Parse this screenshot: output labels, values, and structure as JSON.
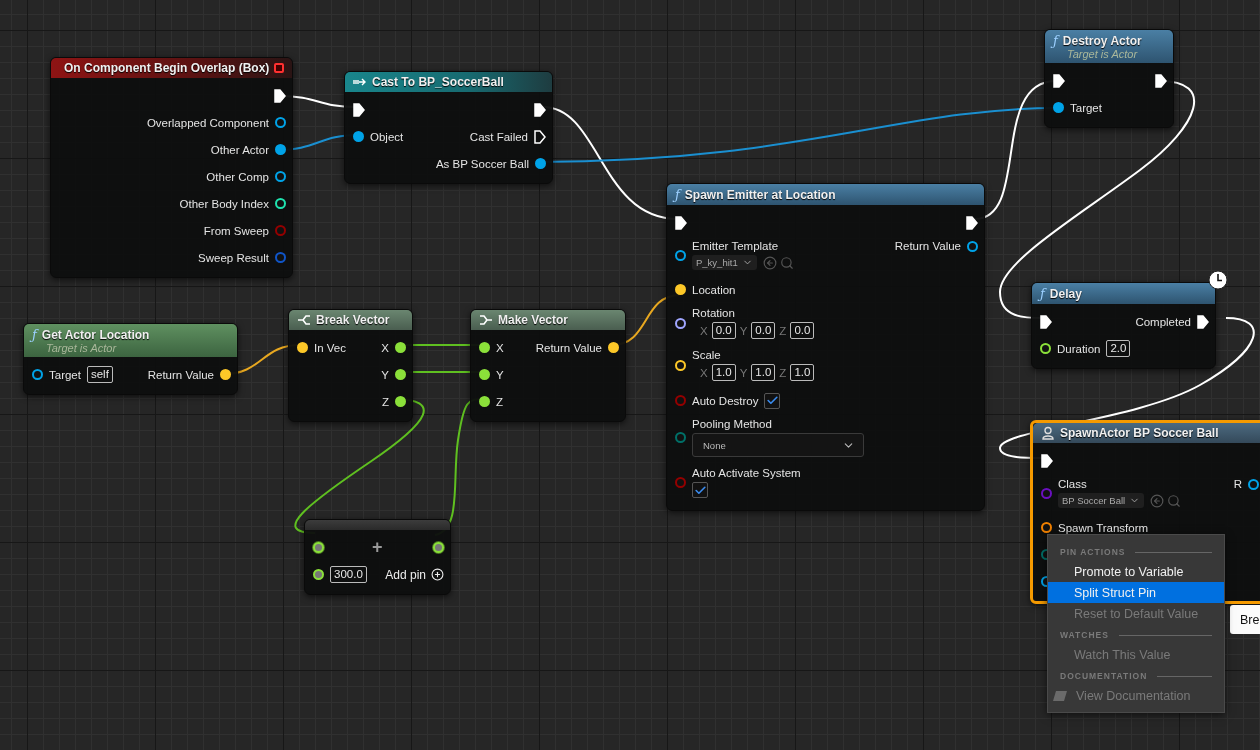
{
  "nodes": [
    {
      "kind": "event",
      "title": "On Component Begin Overlap (Box)",
      "delegate": true,
      "selected": false,
      "rows": [
        {
          "out": {
            "kind": "exec",
            "connected": true
          }
        },
        {
          "out": {
            "kind": "object",
            "label": "Overlapped Component",
            "connected": false
          }
        },
        {
          "out": {
            "kind": "object",
            "label": "Other Actor",
            "connected": true
          }
        },
        {
          "out": {
            "kind": "object",
            "label": "Other Comp",
            "connected": false
          }
        },
        {
          "out": {
            "kind": "int",
            "label": "Other Body Index",
            "connected": false
          }
        },
        {
          "out": {
            "kind": "bool",
            "label": "From Sweep",
            "connected": false
          }
        },
        {
          "out": {
            "kind": "struct",
            "label": "Sweep Result",
            "connected": false
          }
        }
      ]
    },
    {
      "kind": "cast",
      "title": "Cast To BP_SoccerBall",
      "selected": false,
      "rows": [
        {
          "in": {
            "kind": "exec",
            "connected": true
          },
          "out": {
            "kind": "exec",
            "connected": true
          }
        },
        {
          "in": {
            "kind": "object",
            "label": "Object",
            "connected": true
          },
          "out": {
            "kind": "exec",
            "label": "Cast Failed",
            "connected": false
          }
        },
        {
          "out": {
            "kind": "object",
            "label": "As BP Soccer Ball",
            "connected": true
          }
        }
      ]
    },
    {
      "kind": "function",
      "glyph": "ƒ",
      "title": "Destroy Actor",
      "subtitle": "Target is Actor",
      "selected": false,
      "rows": [
        {
          "in": {
            "kind": "exec",
            "connected": true
          },
          "out": {
            "kind": "exec",
            "connected": true
          }
        },
        {
          "in": {
            "kind": "object",
            "label": "Target",
            "connected": true
          }
        }
      ]
    },
    {
      "kind": "function",
      "glyph": "ƒ",
      "title": "Spawn Emitter at Location",
      "selected": false,
      "rows": [
        {
          "in": {
            "kind": "exec",
            "connected": true
          },
          "out": {
            "kind": "exec",
            "connected": true
          }
        },
        {
          "in": {
            "kind": "object",
            "label": "Emitter Template",
            "connected": false,
            "asset": "P_ky_hit1"
          },
          "out": {
            "kind": "object",
            "label": "Return Value",
            "connected": false
          }
        },
        {
          "in": {
            "kind": "vector",
            "label": "Location",
            "connected": true
          }
        },
        {
          "in": {
            "kind": "rotator",
            "label": "Rotation",
            "connected": false,
            "components": [
              {
                "axis": "X",
                "value": "0.0"
              },
              {
                "axis": "Y",
                "value": "0.0"
              },
              {
                "axis": "Z",
                "value": "0.0"
              }
            ]
          }
        },
        {
          "in": {
            "kind": "vector",
            "label": "Scale",
            "connected": false,
            "components": [
              {
                "axis": "X",
                "value": "1.0"
              },
              {
                "axis": "Y",
                "value": "1.0"
              },
              {
                "axis": "Z",
                "value": "1.0"
              }
            ]
          }
        },
        {
          "in": {
            "kind": "bool",
            "label": "Auto Destroy",
            "connected": false,
            "checked": true,
            "stacked": false
          }
        },
        {
          "in": {
            "kind": "enum",
            "label": "Pooling Method",
            "connected": false,
            "dropdown": "None"
          }
        },
        {
          "in": {
            "kind": "bool",
            "label": "Auto Activate System",
            "connected": false,
            "checked": true,
            "stacked": true
          }
        }
      ]
    },
    {
      "kind": "pure",
      "glyph": "ƒ",
      "title": "Get Actor Location",
      "subtitle": "Target is Actor",
      "selected": false,
      "rows": [
        {
          "in": {
            "kind": "object",
            "label": "Target",
            "connected": false,
            "value": "self"
          },
          "out": {
            "kind": "vector",
            "label": "Return Value",
            "connected": true
          }
        }
      ]
    },
    {
      "kind": "break",
      "title": "Break Vector",
      "selected": false,
      "rows": [
        {
          "in": {
            "kind": "vector",
            "label": "In Vec",
            "connected": true
          },
          "out": {
            "kind": "float",
            "label": "X",
            "connected": true
          }
        },
        {
          "out": {
            "kind": "float",
            "label": "Y",
            "connected": true
          }
        },
        {
          "out": {
            "kind": "float",
            "label": "Z",
            "connected": true
          }
        }
      ]
    },
    {
      "kind": "make",
      "title": "Make Vector",
      "selected": false,
      "rows": [
        {
          "in": {
            "kind": "float",
            "label": "X",
            "connected": true
          },
          "out": {
            "kind": "vector",
            "label": "Return Value",
            "connected": true
          }
        },
        {
          "in": {
            "kind": "float",
            "label": "Y",
            "connected": true
          }
        },
        {
          "in": {
            "kind": "float",
            "label": "Z",
            "connected": true
          }
        }
      ]
    },
    {
      "kind": "math",
      "operator": "+",
      "selected": false,
      "rows": [
        {
          "in": {
            "kind": "wildcard",
            "connected": true
          },
          "out": {
            "kind": "wildcard",
            "connected": true
          }
        },
        {
          "in": {
            "kind": "wildcard",
            "connected": false,
            "value": "300.0"
          },
          "out": {
            "kind": "addpin",
            "label": "Add pin"
          }
        }
      ]
    },
    {
      "kind": "function",
      "glyph": "ƒ",
      "title": "Delay",
      "latent": true,
      "selected": false,
      "rows": [
        {
          "in": {
            "kind": "exec",
            "connected": true
          },
          "out": {
            "kind": "exec",
            "label": "Completed",
            "connected": true
          }
        },
        {
          "in": {
            "kind": "float",
            "label": "Duration",
            "connected": false,
            "value": "2.0"
          }
        }
      ]
    },
    {
      "kind": "spawn",
      "title": "SpawnActor BP Soccer Ball",
      "selected": true,
      "rows": [
        {
          "in": {
            "kind": "exec",
            "connected": true
          }
        },
        {
          "in": {
            "kind": "class",
            "label": "Class",
            "connected": false,
            "asset": "BP Soccer Ball"
          },
          "out": {
            "kind": "object",
            "label": "R",
            "connected": false
          }
        },
        {
          "in": {
            "kind": "transform",
            "label": "Spawn Transform",
            "connected": false
          }
        },
        {
          "in": {
            "kind": "enum",
            "connected": false
          }
        },
        {
          "in": {
            "kind": "object",
            "connected": false
          }
        }
      ]
    }
  ],
  "popup": {
    "label": "Bre"
  },
  "menu": {
    "sections": [
      {
        "heading": "PIN ACTIONS",
        "items": [
          {
            "label": "Promote to Variable",
            "kind": "action",
            "selected": false,
            "disabled": false
          },
          {
            "label": "Split Struct Pin",
            "kind": "action",
            "selected": true,
            "disabled": false
          },
          {
            "label": "Reset to Default Value",
            "kind": "action",
            "selected": false,
            "disabled": true
          }
        ]
      },
      {
        "heading": "WATCHES",
        "items": [
          {
            "label": "Watch This Value",
            "kind": "action",
            "selected": false,
            "disabled": true
          }
        ]
      },
      {
        "heading": "DOCUMENTATION",
        "items": [
          {
            "label": "View Documentation",
            "kind": "link",
            "selected": false,
            "disabled": true
          }
        ]
      }
    ]
  }
}
